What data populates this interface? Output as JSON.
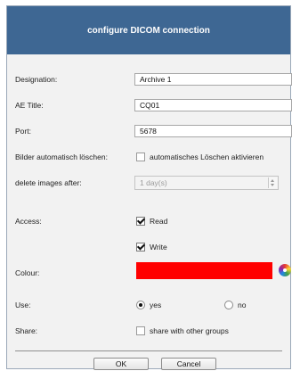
{
  "dialog": {
    "title": "configure DICOM connection",
    "designation": {
      "label": "Designation:",
      "value": "Archive 1"
    },
    "ae_title": {
      "label": "AE Title:",
      "value": "CQ01"
    },
    "port": {
      "label": "Port:",
      "value": "5678"
    },
    "auto_delete": {
      "label": "Bilder automatisch löschen:",
      "checkbox_label": "automatisches Löschen aktivieren",
      "checked": false
    },
    "delete_after": {
      "label": "delete images after:",
      "value": "1 day(s)"
    },
    "access": {
      "label": "Access:",
      "read_label": "Read",
      "read_checked": true,
      "write_label": "Write",
      "write_checked": true
    },
    "colour": {
      "label": "Colour:",
      "value": "#ff0000"
    },
    "use": {
      "label": "Use:",
      "yes_label": "yes",
      "no_label": "no",
      "selected": "yes"
    },
    "share": {
      "label": "Share:",
      "checkbox_label": "share with other groups",
      "checked": false
    },
    "buttons": {
      "ok": "OK",
      "cancel": "Cancel"
    }
  }
}
